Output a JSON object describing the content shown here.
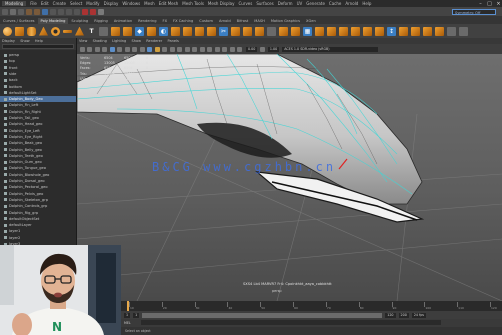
{
  "menubar": {
    "items": [
      "File",
      "Edit",
      "Create",
      "Select",
      "Modify",
      "Display",
      "Windows",
      "Mesh",
      "Edit Mesh",
      "Mesh Tools",
      "Mesh Display",
      "Curves",
      "Surfaces",
      "Deform",
      "UV",
      "Generate",
      "Cache",
      "Arnold",
      "Help"
    ],
    "mode": "Modeling",
    "workspace": "Workspace: Maya Classic"
  },
  "statusline": {
    "search_placeholder": "Symmetry: Off"
  },
  "shelf": {
    "tabs": [
      "Curves / Surfaces",
      "Poly Modeling",
      "Sculpting",
      "Rigging",
      "Animation",
      "Rendering",
      "FX",
      "FX Caching",
      "Custom",
      "Arnold",
      "Bifrost",
      "MASH",
      "Motion Graphics",
      "XGen"
    ],
    "active_tab": "Poly Modeling"
  },
  "outliner": {
    "menus": [
      "Display",
      "Show",
      "Help"
    ],
    "items": [
      "persp",
      "top",
      "front",
      "side",
      "back",
      "bottom",
      "defaultLightSet",
      "Dolphin_Body_Geo",
      "Dolphin_Fin_Left",
      "Dolphin_Fin_Right",
      "Dolphin_Tail_geo",
      "Dolphin_Head_geo",
      "Dolphin_Eye_Left",
      "Dolphin_Eye_Right",
      "Dolphin_Beak_geo",
      "Dolphin_Belly_geo",
      "Dolphin_Teeth_geo",
      "Dolphin_Gum_geo",
      "Dolphin_Tongue_geo",
      "Dolphin_Blowhole_geo",
      "Dolphin_Dorsal_geo",
      "Dolphin_Pectoral_geo",
      "Dolphin_Pelvis_geo",
      "Dolphin_Skeleton_grp",
      "Dolphin_Controls_grp",
      "Dolphin_Rig_grp",
      "defaultObjectSet",
      "defaultLayer",
      "layer1",
      "layer2",
      "layer3"
    ],
    "selected_index": 7
  },
  "viewport": {
    "menus": [
      "View",
      "Shading",
      "Lighting",
      "Show",
      "Renderer",
      "Panels"
    ],
    "stats": [
      {
        "label": "Verts:",
        "a": "6504",
        "b": "6504",
        "c": "0"
      },
      {
        "label": "Edges:",
        "a": "13005",
        "b": "13005",
        "c": "0"
      },
      {
        "label": "Faces:",
        "a": "6504",
        "b": "6504",
        "c": "0"
      },
      {
        "label": "Tris:",
        "a": "13008",
        "b": "13008",
        "c": "0"
      },
      {
        "label": "UVs:",
        "a": "7163",
        "b": "7163",
        "c": "0"
      }
    ],
    "camera_label": "SXS4 Lb4 MARVR7 Fr4: Cpoinkhkt_aaya_cobbkhtt",
    "persp_label": "persp",
    "watermark": "B&CG  www.cgzhbn.cn",
    "field_value": "0.00",
    "gamma_value": "1.00",
    "colorspace": "ACES 1.0 SDR-video (sRGB)"
  },
  "timeline": {
    "ticks": [
      "10",
      "20",
      "30",
      "40",
      "50",
      "60",
      "70",
      "80",
      "90",
      "100",
      "110",
      "120"
    ],
    "start": "1",
    "end": "120",
    "range_start": "1",
    "range_end": "120",
    "max_end": "200",
    "fps": "24 fps"
  },
  "cmdline": {
    "label": "MEL"
  },
  "helpline": {
    "text": "Select an object"
  },
  "webcam": {
    "label": "presenter-webcam"
  }
}
